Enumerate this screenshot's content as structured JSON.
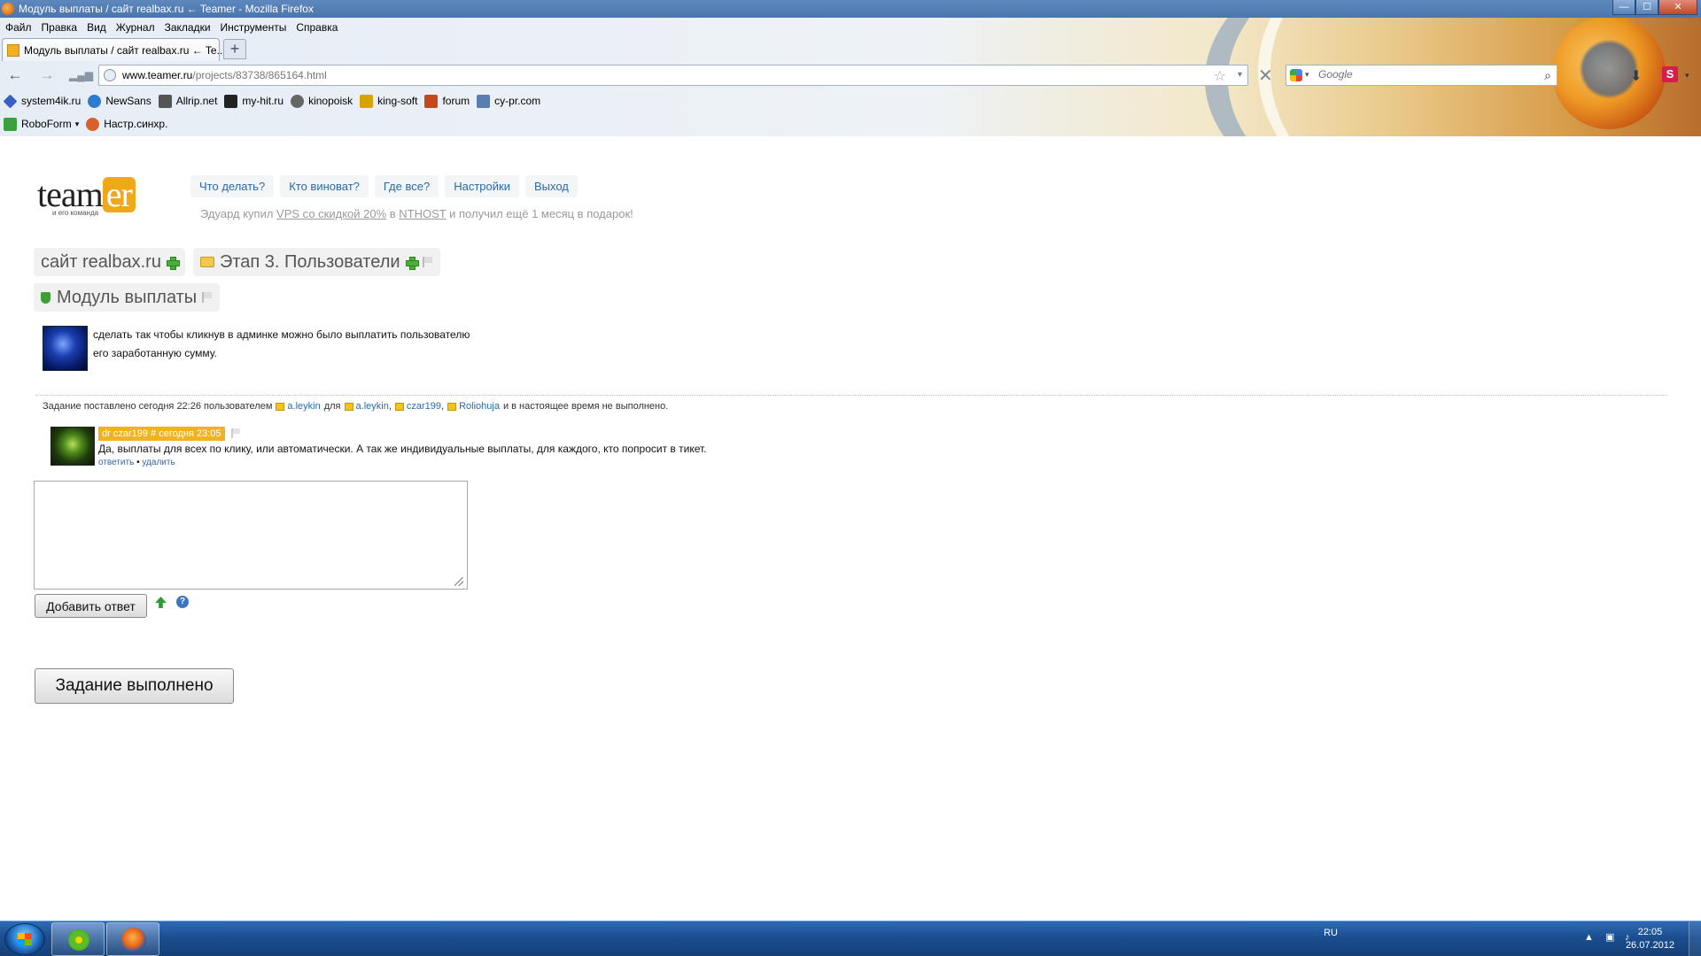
{
  "window": {
    "title": "Модуль выплаты / сайт realbax.ru ← Teamer - Mozilla Firefox",
    "controls": {
      "minimize": "—",
      "maximize": "☐",
      "close": "✕"
    }
  },
  "menu": [
    "Файл",
    "Правка",
    "Вид",
    "Журнал",
    "Закладки",
    "Инструменты",
    "Справка"
  ],
  "tab": {
    "label": "Модуль выплаты / сайт realbax.ru ← Te...",
    "new_tab": "+"
  },
  "nav": {
    "url_host": "www.teamer.ru",
    "url_path": "/projects/83738/865164.html",
    "search_placeholder": "Google"
  },
  "bookmarks": [
    {
      "label": "system4ik.ru",
      "icon": "diamond-icon",
      "color": "#3b5fc0"
    },
    {
      "label": "NewSans",
      "icon": "c-icon",
      "color": "#2c7bd1"
    },
    {
      "label": "Allrip.net",
      "icon": "trees-icon",
      "color": "#555555"
    },
    {
      "label": "my-hit.ru",
      "icon": "clapper-icon",
      "color": "#222222"
    },
    {
      "label": "kinopoisk",
      "icon": "reel-icon",
      "color": "#666666"
    },
    {
      "label": "king-soft",
      "icon": "crown-icon",
      "color": "#d8a300"
    },
    {
      "label": "forum",
      "icon": "forum-icon",
      "color": "#c8461b"
    },
    {
      "label": "cy-pr.com",
      "icon": "pen-icon",
      "color": "#5b7db0"
    }
  ],
  "toolbar2": [
    {
      "label": "RoboForm",
      "icon": "roboform-icon",
      "color": "#3aa23a",
      "dropdown": "▾"
    },
    {
      "label": "Настр.синхр.",
      "icon": "sync-icon",
      "color": "#d9602b"
    }
  ],
  "site": {
    "logo_main": "team",
    "logo_accent": "er",
    "logo_tagline": "и его команда",
    "nav": [
      "Что делать?",
      "Кто виноват?",
      "Где все?",
      "Настройки",
      "Выход"
    ],
    "promo": {
      "before": "Эдуард купил ",
      "link1": "VPS со скидкой 20%",
      "middle": " в ",
      "link2": "NTHOST",
      "after": " и получил ещё 1 месяц в подарок!"
    },
    "crumbs": {
      "project": "сайт realbax.ru",
      "stage": "Этап 3. Пользователи"
    },
    "task_title": "Модуль выплаты",
    "description": [
      "сделать так чтобы кликнув в админке можно было выплатить пользователю",
      "его заработанную сумму."
    ],
    "meta": {
      "prefix": "Задание поставлено сегодня 22:26 пользователем",
      "author": "a.leykin",
      "for": "для",
      "assignees": [
        "a.leykin",
        "czar199",
        "Roliohuja"
      ],
      "suffix": "и в настоящее время не выполнено."
    },
    "comment": {
      "role": "dr",
      "user": "czar199",
      "hash": "#",
      "time": "сегодня 23:05",
      "text": "Да, выплаты для всех по клику, или автоматически. А так же индивидуальные выплаты, для каждого, кто попросит в тикет.",
      "reply": "ответить",
      "sep": "•",
      "delete": "удалить"
    },
    "reply_value": "",
    "add_button": "Добавить ответ",
    "help_icon": "?",
    "done_button": "Задание выполнено"
  },
  "taskbar": {
    "lang": "RU",
    "tray_arrow": "▲",
    "time": "22:05",
    "date": "26.07.2012"
  }
}
